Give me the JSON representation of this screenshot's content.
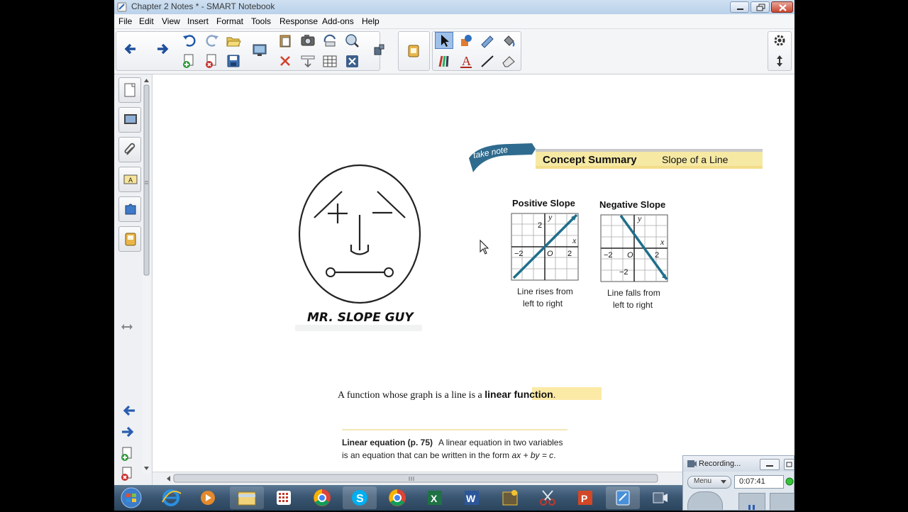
{
  "window": {
    "title": "Chapter 2 Notes * - SMART Notebook"
  },
  "menu": [
    "File",
    "Edit",
    "View",
    "Insert",
    "Format",
    "Tools",
    "Response",
    "Add-ons",
    "Help"
  ],
  "slide": {
    "face_caption": "MR. SLOPE GUY",
    "take_note_banner": "take note",
    "concept_summary": "Concept Summary",
    "concept_topic": "Slope of a Line",
    "positive": {
      "title": "Positive Slope",
      "caption_line1": "Line rises from",
      "caption_line2": "left to right",
      "tick_pos": "2",
      "tick_neg": "−2",
      "origin": "O",
      "x_axis": "x",
      "y_axis": "y"
    },
    "negative": {
      "title": "Negative Slope",
      "caption_line1": "Line falls from",
      "caption_line2": "left to right",
      "tick_pos": "2",
      "tick_neg": "−2",
      "origin": "O",
      "x_axis": "x",
      "y_axis": "y"
    },
    "sentence_start": "A function whose graph is a line is a ",
    "sentence_highlight": "linear function",
    "sentence_end": ".",
    "definition_term": "Linear equation (p. 75)",
    "definition_line1": "A linear equation in two variables",
    "definition_line2_start": "is an equation that can be written in the form ",
    "definition_formula": "ax + by = c",
    "definition_line2_end": "."
  },
  "recorder": {
    "status": "Recording...",
    "menu_label": "Menu",
    "time": "0:07:41"
  },
  "colors": {
    "accent": "#1f6f8b",
    "highlight": "#fbeaa6",
    "banner_gold": "#f2dd8a",
    "taskbar": "#3a5672"
  }
}
